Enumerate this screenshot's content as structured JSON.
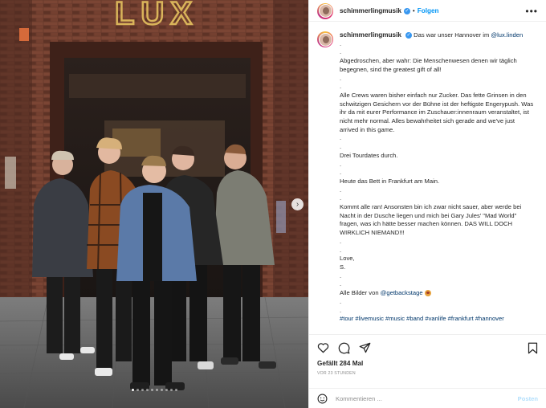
{
  "post": {
    "username": "schimmerlingmusik",
    "separator": "•",
    "follow_label": "Folgen",
    "more_label": "•••",
    "sign_text": "LUX",
    "verified_mark": "✓"
  },
  "caption": {
    "username": "schimmerlingmusik",
    "intro_text": "Das war unser Hannover im",
    "mention_lux": "@lux.linden",
    "lines": [
      ".",
      ".",
      "Abgedroschen, aber wahr: Die Menschenwesen denen wir täglich begegnen, sind the greatest gift of all!",
      ".",
      ".",
      "Alle Crews waren bisher einfach nur Zucker. Das fette Grinsen in den schwitzigen Gesichern vor der Bühne ist der heftigste Engerypush. Was ihr da mit eurer Performance im Zuschauer:innenraum veranstaltet, ist nicht mehr normal. Alles bewahrheitet sich gerade and we've just arrived in this game.",
      ".",
      ".",
      "Drei Tourdates durch.",
      ".",
      ".",
      "Heute das Bett in Frankfurt am Main.",
      ".",
      ".",
      "Kommt alle ran! Ansonsten bin ich zwar nicht sauer, aber werde bei Nacht in der Dusche liegen und mich bei Gary Jules' \"Mad World\" fragen, was ich hätte besser machen können. DAS WILL DOCH WIRKLICH NIEMAND!!!",
      ".",
      ".",
      "Love,",
      "S.",
      ".",
      "."
    ],
    "photo_credit_text": "Alle Bilder von",
    "photo_credit_mention": "@getbackstage",
    "after_credit": [
      ".",
      "."
    ],
    "hashtags": "#tour #livemusic #music #band #vanlife #frankfurt #hannover"
  },
  "actions": {
    "likes": "Gefällt 284 Mal",
    "time": "VOR 23 STUNDEN"
  },
  "comment": {
    "placeholder": "Kommentieren ...",
    "post_label": "Posten"
  },
  "carousel": {
    "slide_count": 10,
    "active_index": 0
  },
  "icons": {
    "next": "chevron-right-icon",
    "like": "heart-icon",
    "comment": "comment-icon",
    "share": "paper-plane-icon",
    "save": "bookmark-icon",
    "emoji": "smiley-icon"
  }
}
